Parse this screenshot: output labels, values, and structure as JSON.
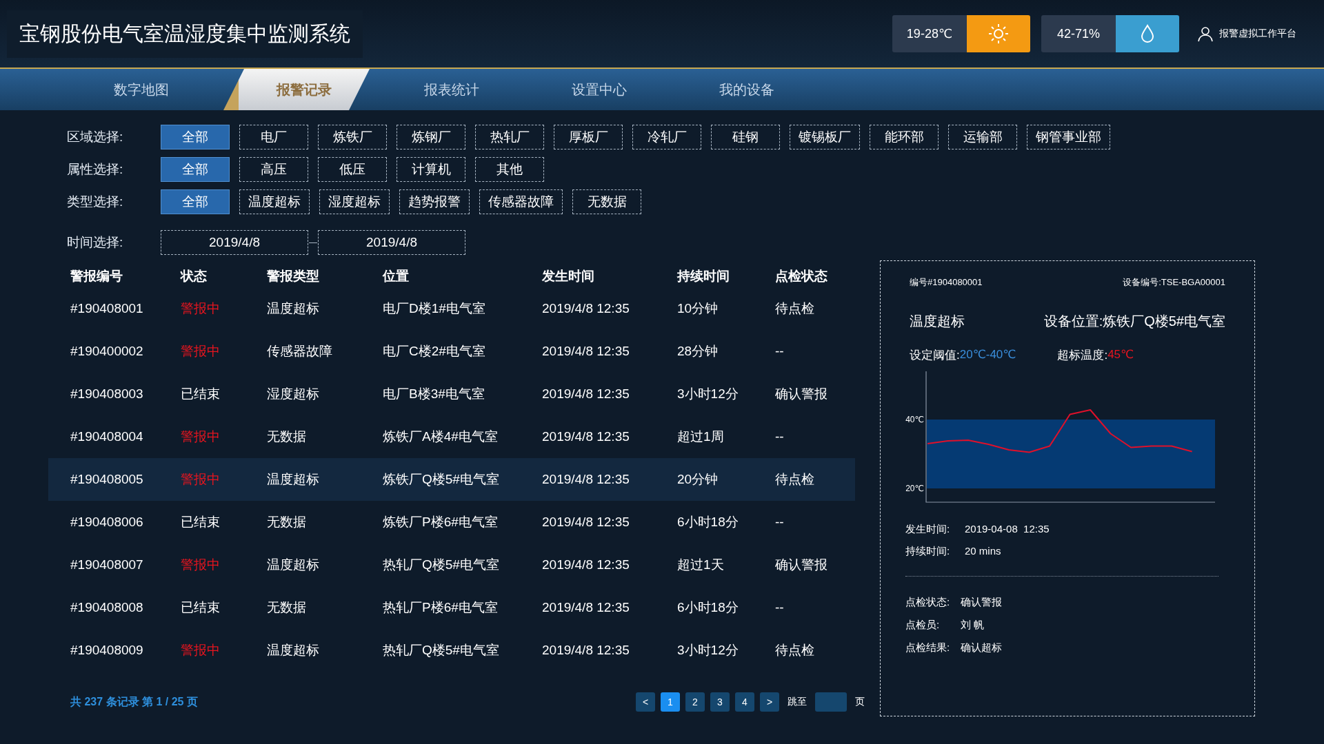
{
  "header": {
    "title": "宝钢股份电气室温湿度集中监测系统",
    "temperature": {
      "range": "19-28℃"
    },
    "humidity": {
      "range": "42-71%"
    },
    "user": {
      "name": "报警虚拟工作平台"
    }
  },
  "nav": [
    {
      "label": "数字地图",
      "selected": false
    },
    {
      "label": "报警记录",
      "selected": true
    },
    {
      "label": "报表统计",
      "selected": false
    },
    {
      "label": "设置中心",
      "selected": false
    },
    {
      "label": "我的设备",
      "selected": false
    }
  ],
  "filters": [
    {
      "label": "区域选择:",
      "kind": "chips",
      "options": [
        {
          "label": "全部",
          "selected": true
        },
        {
          "label": "电厂",
          "selected": false
        },
        {
          "label": "炼铁厂",
          "selected": false
        },
        {
          "label": "炼钢厂",
          "selected": false
        },
        {
          "label": "热轧厂",
          "selected": false
        },
        {
          "label": "厚板厂",
          "selected": false
        },
        {
          "label": "冷轧厂",
          "selected": false
        },
        {
          "label": "硅钢",
          "selected": false
        },
        {
          "label": "镀锡板厂",
          "selected": false
        },
        {
          "label": "能环部",
          "selected": false
        },
        {
          "label": "运输部",
          "selected": false
        },
        {
          "label": "钢管事业部",
          "selected": false
        }
      ]
    },
    {
      "label": "属性选择:",
      "kind": "chips",
      "options": [
        {
          "label": "全部",
          "selected": true
        },
        {
          "label": "高压",
          "selected": false
        },
        {
          "label": "低压",
          "selected": false
        },
        {
          "label": "计算机",
          "selected": false
        },
        {
          "label": "其他",
          "selected": false
        }
      ]
    },
    {
      "label": "类型选择:",
      "kind": "chips",
      "options": [
        {
          "label": "全部",
          "selected": true
        },
        {
          "label": "温度超标",
          "selected": false
        },
        {
          "label": "湿度超标",
          "selected": false
        },
        {
          "label": "趋势报警",
          "selected": false
        },
        {
          "label": "传感器故障",
          "selected": false
        },
        {
          "label": "无数据",
          "selected": false
        }
      ]
    },
    {
      "label": "时间选择:",
      "kind": "dates",
      "from": "2019/4/8",
      "to": "2019/4/8"
    }
  ],
  "table": {
    "columns": [
      "警报编号",
      "状态",
      "警报类型",
      "位置",
      "发生时间",
      "持续时间",
      "点检状态"
    ],
    "rows": [
      {
        "alarm": true,
        "selected": false,
        "cells": [
          "#190408001",
          "警报中",
          "温度超标",
          "电厂D楼1#电气室",
          "2019/4/8 12:35",
          "10分钟",
          "待点检"
        ]
      },
      {
        "alarm": true,
        "selected": false,
        "cells": [
          "#190400002",
          "警报中",
          "传感器故障",
          "电厂C楼2#电气室",
          "2019/4/8 12:35",
          "28分钟",
          "--"
        ]
      },
      {
        "alarm": false,
        "selected": false,
        "cells": [
          "#190408003",
          "已结束",
          "湿度超标",
          "电厂B楼3#电气室",
          "2019/4/8 12:35",
          "3小时12分",
          "确认警报"
        ]
      },
      {
        "alarm": true,
        "selected": false,
        "cells": [
          "#190408004",
          "警报中",
          "无数据",
          "炼铁厂A楼4#电气室",
          "2019/4/8 12:35",
          "超过1周",
          "--"
        ]
      },
      {
        "alarm": true,
        "selected": true,
        "cells": [
          "#190408005",
          "警报中",
          "温度超标",
          "炼铁厂Q楼5#电气室",
          "2019/4/8 12:35",
          "20分钟",
          "待点检"
        ]
      },
      {
        "alarm": false,
        "selected": false,
        "cells": [
          "#190408006",
          "已结束",
          "无数据",
          "炼铁厂P楼6#电气室",
          "2019/4/8 12:35",
          "6小时18分",
          "--"
        ]
      },
      {
        "alarm": true,
        "selected": false,
        "cells": [
          "#190408007",
          "警报中",
          "温度超标",
          "热轧厂Q楼5#电气室",
          "2019/4/8 12:35",
          "超过1天",
          "确认警报"
        ]
      },
      {
        "alarm": false,
        "selected": false,
        "cells": [
          "#190408008",
          "已结束",
          "无数据",
          "热轧厂P楼6#电气室",
          "2019/4/8 12:35",
          "6小时18分",
          "--"
        ]
      },
      {
        "alarm": true,
        "selected": false,
        "cells": [
          "#190408009",
          "警报中",
          "温度超标",
          "热轧厂Q楼5#电气室",
          "2019/4/8 12:35",
          "3小时12分",
          "待点检"
        ]
      }
    ]
  },
  "footer": {
    "summary": "共 237 条记录 第 1 / 25 页"
  },
  "pagination": {
    "prev": "<",
    "pages": [
      {
        "label": "1",
        "selected": true
      },
      {
        "label": "2",
        "selected": false
      },
      {
        "label": "3",
        "selected": false
      },
      {
        "label": "4",
        "selected": false
      }
    ],
    "next": ">",
    "jump_label": "跳至",
    "page_suffix": "页"
  },
  "detail": {
    "id": "编号#1904080001",
    "device_label": "设备编号:",
    "device_no": "TSE-BGA00001",
    "type": "温度超标",
    "location_label": "设备位置:",
    "location": "炼铁厂Q楼5#电气室",
    "threshold_label": "设定阈值:",
    "threshold": "20℃-40℃",
    "over_label": "超标温度:",
    "over": "45℃",
    "chart_data": {
      "type": "line",
      "categories": [
        null,
        null,
        null,
        null,
        null,
        null,
        null,
        null,
        null,
        null,
        null,
        null,
        null,
        null
      ],
      "ylim": [
        16,
        54
      ],
      "yticks": [
        {
          "value": 20,
          "label": "20℃"
        },
        {
          "value": 40,
          "label": "40℃"
        }
      ],
      "series": [
        {
          "color": "#e0102a",
          "values": [
            33,
            33.8,
            34,
            32.8,
            31.2,
            30.5,
            32.3,
            41.5,
            42.8,
            35.9,
            31.9,
            32.3,
            32.3,
            30.7
          ]
        }
      ]
    },
    "info": [
      {
        "label": "发生时间:",
        "value": "2019-04-08  12:35"
      },
      {
        "label": "持续时间:",
        "value": "20 mins"
      }
    ],
    "inspection": [
      {
        "label": "点检状态:",
        "value": "确认警报"
      },
      {
        "label": "点检员:",
        "value": "刘 帆"
      },
      {
        "label": "点检结果:",
        "value": "确认超标"
      }
    ]
  }
}
